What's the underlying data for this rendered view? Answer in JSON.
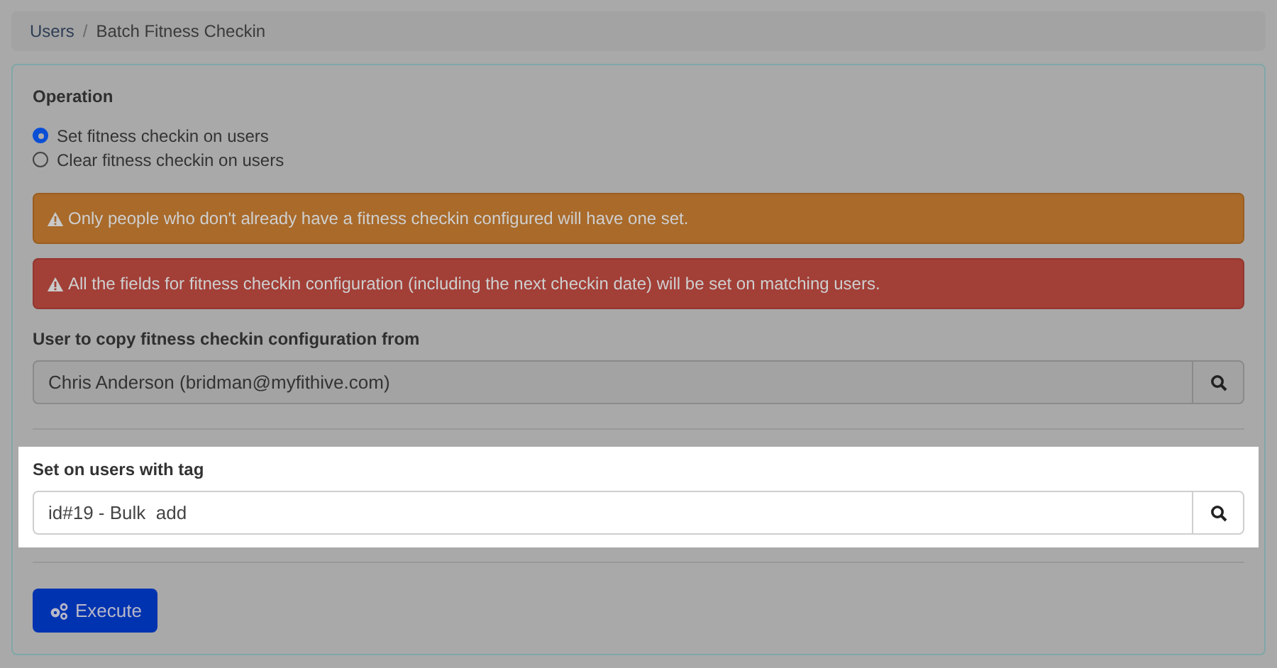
{
  "breadcrumb": [
    "Users",
    "Batch Fitness Checkin"
  ],
  "breadcrumb_separator": "/",
  "operation": {
    "label": "Operation",
    "options": [
      {
        "label": "Set fitness checkin on users",
        "selected": true
      },
      {
        "label": "Clear fitness checkin on users",
        "selected": false
      }
    ]
  },
  "alerts": [
    {
      "kind": "warning",
      "text": "Only people who don't already have a fitness checkin configured will have one set."
    },
    {
      "kind": "danger",
      "text": "All the fields for fitness checkin configuration (including the next checkin date) will be set on matching users."
    }
  ],
  "copy_from": {
    "label": "User to copy fitness checkin configuration from",
    "value": "Chris Anderson (bridman@myfithive.com)"
  },
  "tag": {
    "label": "Set on users with tag",
    "value": "id#19 - Bulk  add"
  },
  "button": "Execute"
}
